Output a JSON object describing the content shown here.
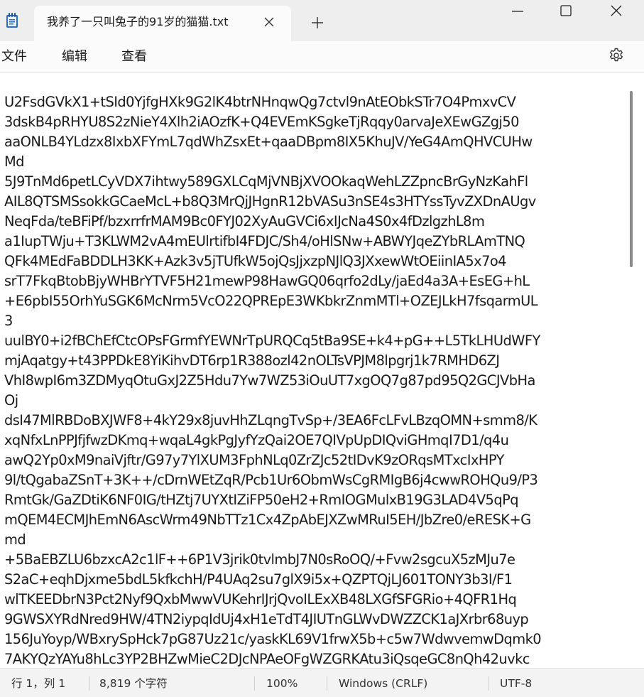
{
  "window": {
    "tab_title": "我养了一只叫兔子的91岁的猫猫.txt",
    "new_tab_label": "+"
  },
  "icons": {
    "app": "notepad-icon",
    "tab_close": "close-icon",
    "new_tab": "plus-icon",
    "minimize": "minimize-icon",
    "maximize": "maximize-icon",
    "close": "close-icon",
    "settings": "gear-icon"
  },
  "menu": {
    "file": "文件",
    "edit": "编辑",
    "view": "查看"
  },
  "editor": {
    "lines": [
      "U2FsdGVkX1+tSId0YjfgHXk9G2lK4btrNHnqwQg7ctvl9nAtEObkSTr7O4PmxvCV",
      "3dskB4pRHYU8S2zNieY4Xlh2iAOzfK+Q4EVEmKSgkeTjRqqy0arvaJeXEwGZgj50",
      "aaONLB4YLdzx8IxbXFYmL7qdWhZsxEt+qaaDBpm8IX5KhuJV/YeG4AmQHVCUHw",
      "Md",
      "5J9TnMd6petLCyVDX7ihtwy589GXLCqMjVNBjXVOOkaqWehLZZpncBrGyNzKahFl",
      "AIL8QTSMSsokkGCaeMcL+b8Q3MrQjJHgnR12bVASu3nSE4s3HTYssTyvZXDnAUgv",
      "NeqFda/teBFiPf/bzxrrfrMAM9Bc0FYJ02XyAuGVCi6xIJcNa4S0x4fDzlgzhL8m",
      "a1IupTWju+T3KLWM2vA4mEUlrtifbI4FDJC/Sh4/oHlSNw+ABWYJqeZYbRLAmTNQ",
      "QFk4MEdFaBDDLH3KK+Azk3v5jTUfkW5ojQsJjxzpNJlQ3JXxewWtOEiinIA5x7o4",
      "srT7FkqBtobBjyWHBrYTVF5H21mewP98HawGQ06qrfo2dLy/jaEd4a3A+EsEG+hL",
      "+E6pbI55OrhYuSGK6McNrm5VcO22QPREpE3WKbkrZnmMTl+OZEJLkH7fsqarmUL",
      "3",
      "uulBY0+i2fBChEfCtcOPsFGrmfYEWNrTpURQCq5tBa9SE+k4+pG++L5TkLHUdWFY",
      "mjAqatgy+t43PPDkE8YiKihvDT6rp1R388ozl42nOLTsVPJM8lpgrj1k7RMHD6ZJ",
      "VhI8wpI6m3ZDMyqOtuGxJ2Z5Hdu7Yw7WZ53iOuUT7xgOQ7g87pd95Q2GCJVbHa",
      "Oj",
      "dsI47MlRBDoBXJWF8+4kY29x8juvHhZLqngTvSp+/3EA6FcLFvLBzqOMN+smm8/K",
      "xqNfxLnPPJfjfwzDKmq+wqaL4gkPgJyfYzQai2OE7QIVpUpDIQviGHmqI7D1/q4u",
      "awQ2Yp0xM9naiVjftr/G97y7YlXUM3FphNLq0ZrZJc52tIDvK9zORqsMTxcIxHPY",
      "9l/tQgabaZSnT+3K++/cDrnWEtZqR/Pcb1Ur6ObmWsCgRMIgB6j4cwwROHQu9/P3",
      "RmtGk/GaZDtiK6NF0IG/tHZtj7UYXtIZiFP50eH2+RmIOGMulxB19G3LAD4V5qPq",
      "mQEM4ECMJhEmN6AscWrm49NbTTz1Cx4ZpAbEJXZwMRuI5EH/JbZre0/eRESK+G",
      "md",
      "+5BaEBZLU6bzxcA2c1lF++6P1V3jrik0tvlmbJ7N0sRoOQ/+Fvw2sgcuX5zMJu7e",
      "S2aC+eqhDjxme5bdL5kfkchH/P4UAq2su7glX9i5x+QZPTQjLJ601TONY3b3I/F1",
      "wlTKEEDbrN3Pct2Nyf9QxbMwwVUKehrIJrjQvoILExXB48LXGfSFGRio+4QFR1Hq",
      "9GWSXYRdNred9HW/4TN2iypqIdUj4xH1eTdT4JIUTnGLWvDWZZCK1aJXrbr68uyp",
      "156JuYoyp/WBxrySpHck7pG87Uz21c/yaskKL69V1frwX5b+c5w7WdwvemwDqmk0",
      "7AKYQzYAYu8hLc3YP2BHZwMieC2DJcNPAeOFgWZGRKAtu3iQsqeGC8nQh42uvkc"
    ]
  },
  "status": {
    "position": "行 1，列 1",
    "char_count": "8,819 个字符",
    "zoom": "100%",
    "line_ending": "Windows (CRLF)",
    "encoding": "UTF-8"
  }
}
